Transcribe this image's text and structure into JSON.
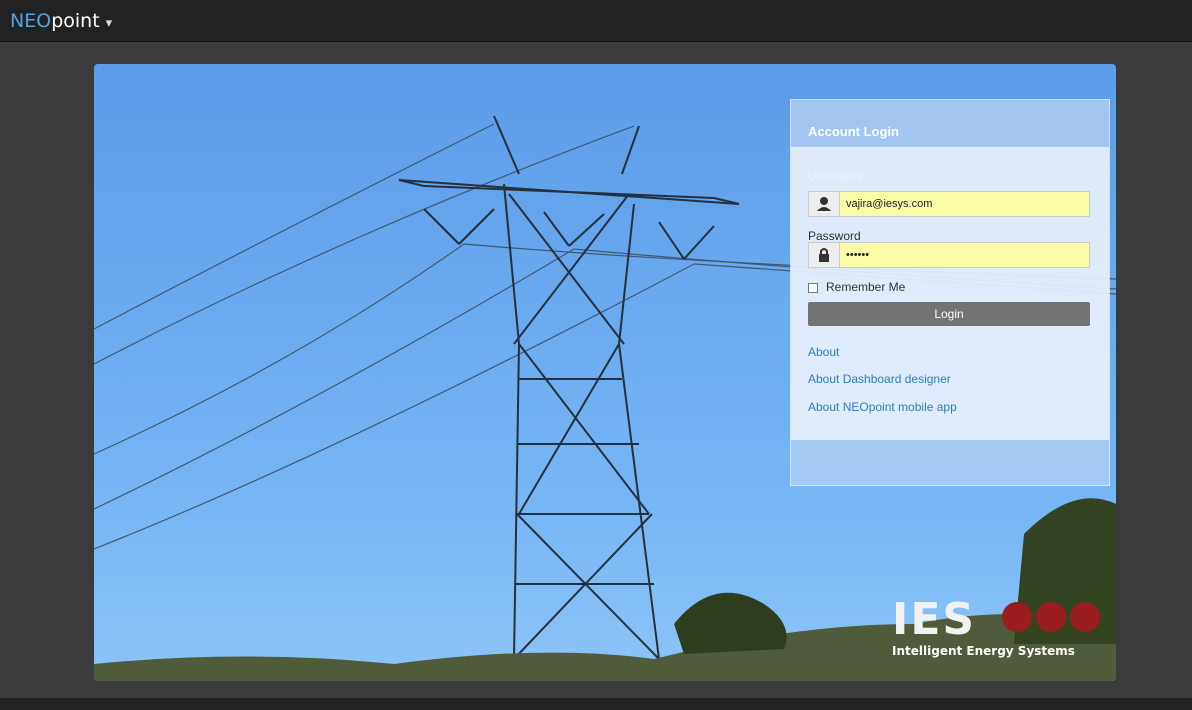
{
  "app": {
    "brand_neo": "NEO",
    "brand_point": "point",
    "caret": "▾"
  },
  "login": {
    "title": "Account Login",
    "username_label": "Username",
    "username_value": "vajira@iesys.com",
    "password_label": "Password",
    "password_value": "••••••",
    "remember_label": "Remember Me",
    "login_button": "Login"
  },
  "links": [
    "About",
    "About Dashboard designer",
    "About NEOpoint mobile app"
  ],
  "logo": {
    "text": "IES",
    "tagline": "Intelligent Energy Systems"
  },
  "colors": {
    "accent": "#4fa3e0",
    "link": "#2a7ec1",
    "button": "#737373",
    "autofill": "#fbfca8",
    "logo_dot": "#9b1c1c"
  },
  "icons": {
    "username": "user-icon",
    "password": "lock-icon"
  }
}
